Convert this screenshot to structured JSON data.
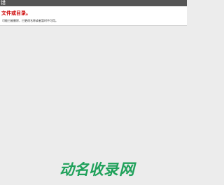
{
  "header": {
    "title": "错"
  },
  "error": {
    "title": "文件或目录。",
    "description": "可能已被删除，已更改名称或者暂时不可用。"
  },
  "watermark": {
    "brand_cjk": "动名收录",
    "brand_latin": "网",
    "color": "#1fa15a"
  }
}
